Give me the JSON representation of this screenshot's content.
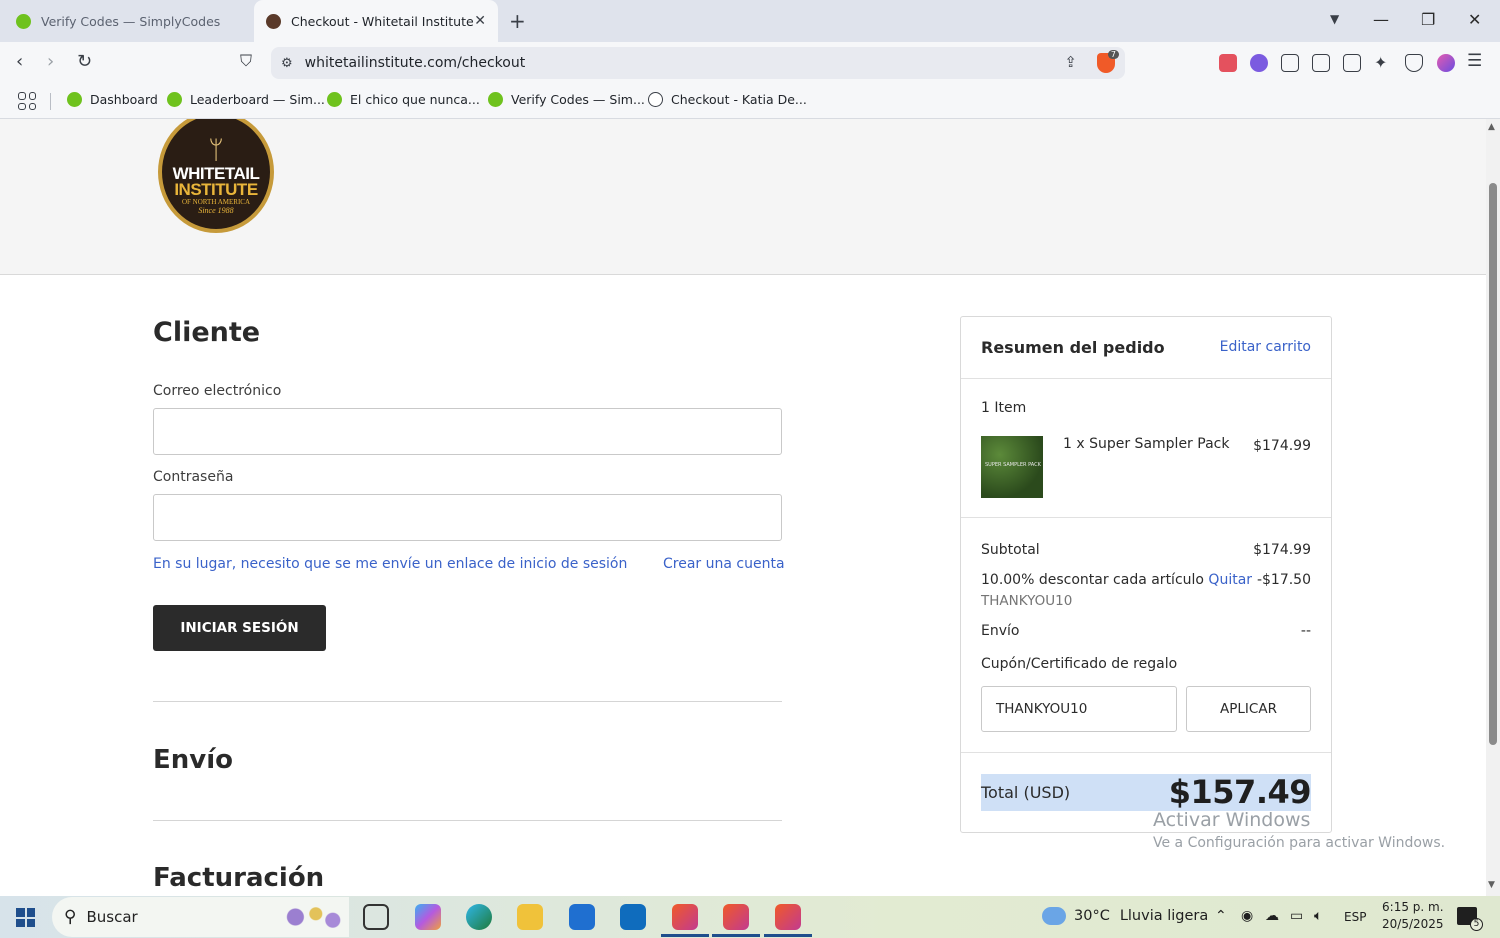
{
  "browser": {
    "tabs": [
      {
        "title": "Verify Codes — SimplyCodes",
        "active": false
      },
      {
        "title": "Checkout - Whitetail Institute",
        "active": true
      }
    ],
    "url": "whitetailinstitute.com/checkout",
    "shield_count": "7",
    "bookmarks": [
      {
        "label": "Dashboard"
      },
      {
        "label": "Leaderboard — Sim..."
      },
      {
        "label": "El chico que nunca..."
      },
      {
        "label": "Verify Codes — Sim..."
      },
      {
        "label": "Checkout - Katia De..."
      }
    ]
  },
  "logo": {
    "line1": "WHITETAIL",
    "line2": "INSTITUTE",
    "line3": "OF NORTH AMERICA",
    "line4": "Since 1988"
  },
  "customer": {
    "heading": "Cliente",
    "email_label": "Correo electrónico",
    "email_value": "",
    "password_label": "Contraseña",
    "password_value": "",
    "magic_link": "En su lugar, necesito que se me envíe un enlace de inicio de sesión",
    "create_account": "Crear una cuenta",
    "login_button": "INICIAR SESIÓN"
  },
  "sections": {
    "shipping": "Envío",
    "billing": "Facturación"
  },
  "summary": {
    "title": "Resumen del pedido",
    "edit_cart": "Editar carrito",
    "item_count": "1 Item",
    "item_thumb_text": "SUPER SAMPLER PACK",
    "item_name": "1 x Super Sampler Pack",
    "item_price": "$174.99",
    "subtotal_label": "Subtotal",
    "subtotal_value": "$174.99",
    "discount_label": "10.00% descontar cada artículo",
    "discount_remove": "Quitar",
    "discount_code": "THANKYOU10",
    "discount_value": "-$17.50",
    "shipping_label": "Envío",
    "shipping_value": "--",
    "coupon_label": "Cupón/Certificado de regalo",
    "coupon_value": "THANKYOU10",
    "apply_button": "APLICAR",
    "total_label": "Total (USD)",
    "total_value": "$157.49"
  },
  "watermark": {
    "line1": "Activar Windows",
    "line2": "Ve a Configuración para activar Windows."
  },
  "taskbar": {
    "search_label": "Buscar",
    "weather_temp": "30°C",
    "weather_desc": "Lluvia ligera",
    "language": "ESP",
    "time": "6:15 p. m.",
    "date": "20/5/2025",
    "notifications": "5"
  },
  "colors": {
    "accent_link": "#3a62c9",
    "button_dark": "#2b2b2b",
    "total_highlight": "#cfe0f6"
  }
}
